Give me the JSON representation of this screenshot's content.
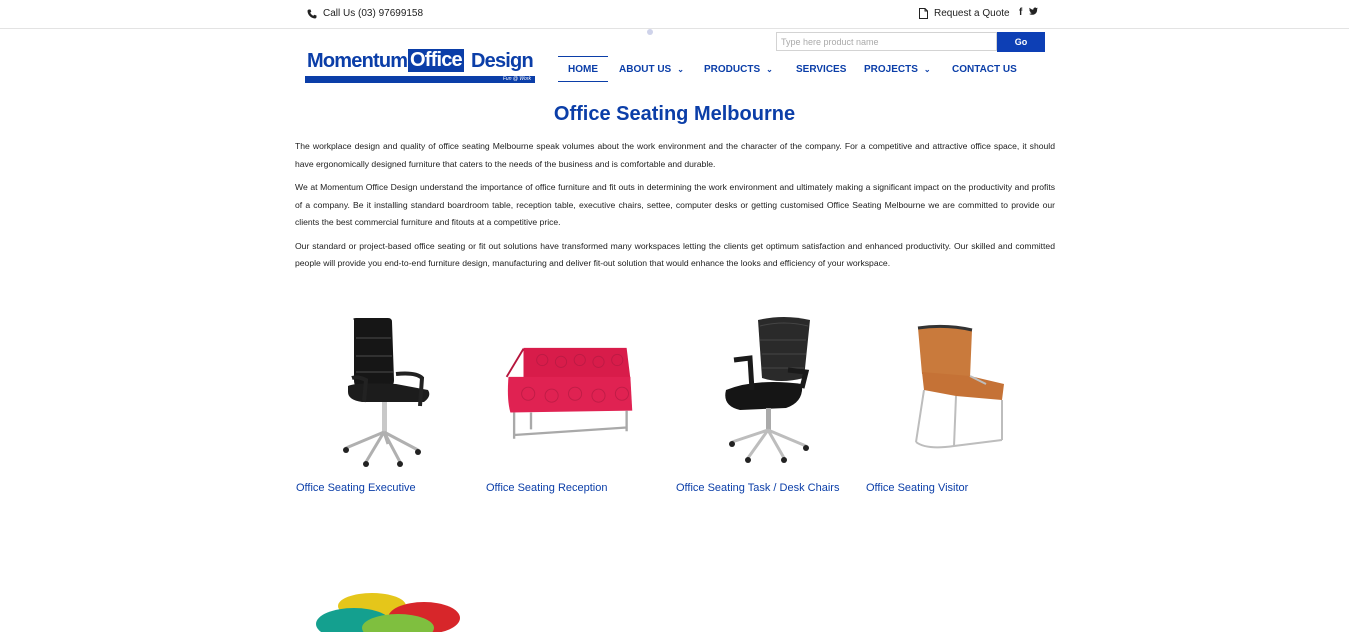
{
  "topbar": {
    "phone_icon": "phone-icon",
    "call_text": "Call Us (03) 97699158",
    "quote_icon": "document-icon",
    "quote_text": "Request a Quote",
    "facebook": "f",
    "twitter": "twitter-icon"
  },
  "logo": {
    "part1": "Momentum",
    "part2": "Office",
    "part3": "Design",
    "tagline": "Fun @ Work"
  },
  "search": {
    "placeholder": "Type here product name",
    "value": "",
    "button_label": "Go"
  },
  "nav": {
    "items": [
      {
        "label": "HOME",
        "active": true,
        "dropdown": false
      },
      {
        "label": "ABOUT US",
        "active": false,
        "dropdown": true
      },
      {
        "label": "PRODUCTS",
        "active": false,
        "dropdown": true
      },
      {
        "label": "SERVICES",
        "active": false,
        "dropdown": false
      },
      {
        "label": "PROJECTS",
        "active": false,
        "dropdown": true
      },
      {
        "label": "CONTACT US",
        "active": false,
        "dropdown": false
      }
    ]
  },
  "page": {
    "title": "Office Seating Melbourne",
    "paragraphs": [
      "The workplace design and quality of office seating Melbourne speak volumes about the work environment and the character of the company. For a competitive and attractive office space, it should have ergonomically designed furniture that caters to the needs of the business and is comfortable and durable.",
      "We at Momentum Office Design understand the importance of office furniture and fit outs in determining the work environment and ultimately making a significant impact on the productivity and profits of a company. Be it installing standard boardroom table, reception table, executive chairs, settee, computer desks or getting customised Office Seating Melbourne we are committed to provide our clients the best commercial furniture and fitouts at a competitive price.",
      "Our standard or project-based office seating or fit out solutions have transformed many workspaces letting the clients get optimum satisfaction and enhanced productivity. Our skilled and committed people will provide you end-to-end furniture design, manufacturing and deliver fit-out solution that would enhance the looks and efficiency of your workspace."
    ]
  },
  "products": [
    {
      "label": "Office Seating Executive",
      "image": "executive-chair"
    },
    {
      "label": "Office Seating Reception",
      "image": "reception-settee"
    },
    {
      "label": "Office Seating Task / Desk Chairs",
      "image": "task-chair"
    },
    {
      "label": "Office Seating Visitor",
      "image": "visitor-chair"
    }
  ],
  "colors": {
    "brand": "#0b3ea8",
    "button": "#0d3fb5"
  }
}
